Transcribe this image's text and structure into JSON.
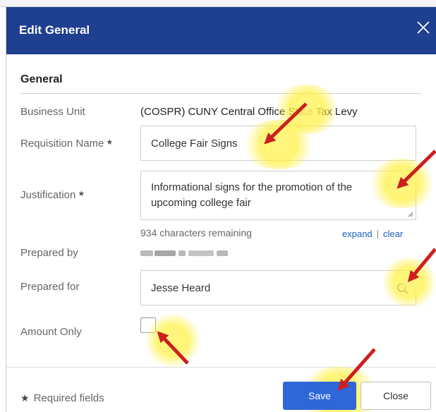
{
  "dialog": {
    "title": "Edit General",
    "close_icon": "close-icon"
  },
  "section": {
    "title": "General"
  },
  "fields": {
    "business_unit": {
      "label": "Business Unit",
      "value": "(COSPR) CUNY Central Office State Tax Levy"
    },
    "requisition_name": {
      "label": "Requisition Name",
      "required": "★",
      "value": "College Fair Signs"
    },
    "justification": {
      "label": "Justification",
      "required": "★",
      "value": "Informational signs for the promotion of the upcoming college fair"
    },
    "chars_count": "934",
    "chars_suffix": " characters remaining",
    "expand_link": "expand",
    "link_sep": "|",
    "clear_link": "clear",
    "prepared_by": {
      "label": "Prepared by"
    },
    "prepared_for": {
      "label": "Prepared for",
      "value": "Jesse Heard",
      "search_icon": "search-icon"
    },
    "amount_only": {
      "label": "Amount Only",
      "checked": false
    }
  },
  "footer": {
    "required_star": "★",
    "required_text": "Required fields",
    "save_label": "Save",
    "close_label": "Close"
  },
  "colors": {
    "header": "#1f3f8f",
    "save_button": "#2f67d8",
    "annotation_arrow": "#cc1f1f",
    "annotation_glow": "#fff24a"
  }
}
